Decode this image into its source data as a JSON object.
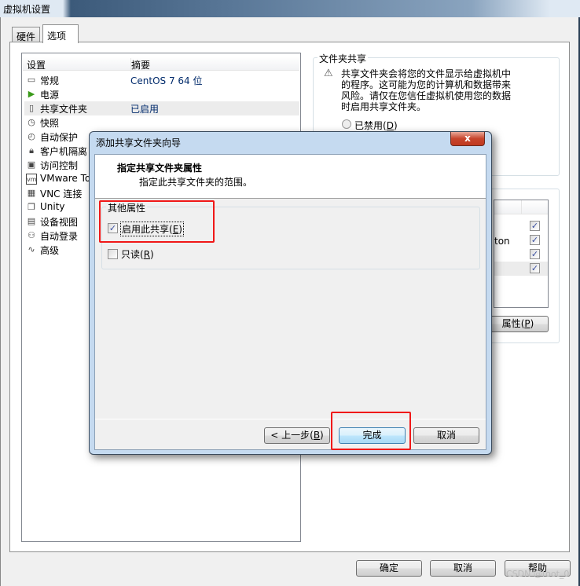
{
  "window": {
    "title": "虚拟机设置"
  },
  "tabs": [
    {
      "label": "硬件"
    },
    {
      "label": "选项"
    }
  ],
  "settings_list": {
    "columns": [
      "设置",
      "摘要"
    ],
    "rows": [
      {
        "name": "常规",
        "summary": "CentOS 7 64 位",
        "icon": "monitor-icon"
      },
      {
        "name": "电源",
        "summary": "",
        "icon": "play-icon"
      },
      {
        "name": "共享文件夹",
        "summary": "已启用",
        "icon": "folder-share-icon",
        "selected": true
      },
      {
        "name": "快照",
        "summary": "",
        "icon": "snapshot-icon"
      },
      {
        "name": "自动保护",
        "summary": "",
        "icon": "clock-icon"
      },
      {
        "name": "客户机隔离",
        "summary": "",
        "icon": "lock-icon"
      },
      {
        "name": "访问控制",
        "summary": "",
        "icon": "access-lock-icon"
      },
      {
        "name": "VMware To",
        "summary": "",
        "icon": "vm-icon"
      },
      {
        "name": "VNC 连接",
        "summary": "",
        "icon": "vnc-icon"
      },
      {
        "name": "Unity",
        "summary": "",
        "icon": "unity-icon"
      },
      {
        "name": "设备视图",
        "summary": "",
        "icon": "device-view-icon"
      },
      {
        "name": "自动登录",
        "summary": "",
        "icon": "users-icon"
      },
      {
        "name": "高级",
        "summary": "",
        "icon": "pulse-icon"
      }
    ]
  },
  "folder_sharing": {
    "title": "文件夹共享",
    "warning": "共享文件夹会将您的文件显示给虚拟机中的程序。这可能为您的计算机和数据带来风险。请仅在您信任虚拟机使用您的数据时启用共享文件夹。",
    "disabled_radio": "已禁用",
    "disabled_key": "D",
    "partial_text": "ton",
    "properties_button": "属性",
    "properties_key": "P"
  },
  "dialog": {
    "title": "添加共享文件夹向导",
    "heading": "指定共享文件夹属性",
    "subheading": "指定此共享文件夹的范围。",
    "group_title": "其他属性",
    "enable_label": "启用此共享",
    "enable_key": "E",
    "enable_checked": true,
    "readonly_label": "只读",
    "readonly_key": "R",
    "readonly_checked": false,
    "back_button": "< 上一步",
    "back_key": "B",
    "finish_button": "完成",
    "cancel_button": "取消",
    "close_glyph": "x"
  },
  "footer": {
    "ok": "确定",
    "cancel": "取消",
    "help": "帮助"
  },
  "watermark": "CSDN @root_0",
  "colors": {
    "highlight": "#f01818",
    "accent": "#3c7fb1"
  }
}
